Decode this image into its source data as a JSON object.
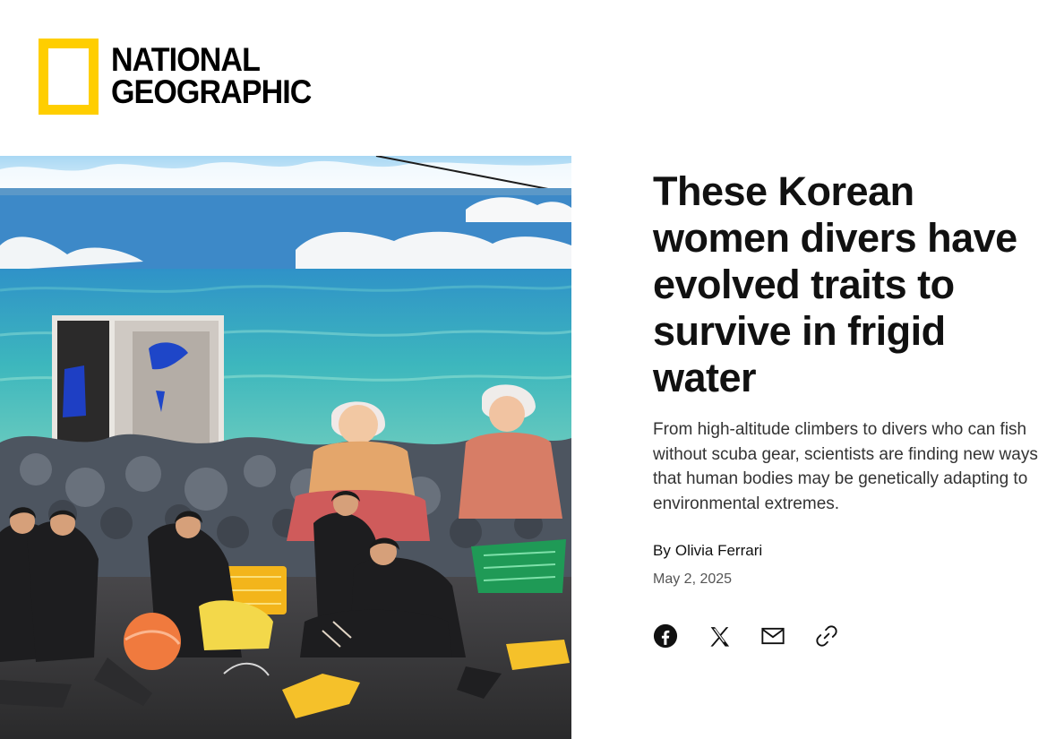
{
  "brand": {
    "logo_line1": "NATIONAL",
    "logo_line2": "GEOGRAPHIC",
    "accent_color": "#ffce00"
  },
  "article": {
    "headline": "These Korean women divers have evolved traits to survive in frigid water",
    "dek": "From high-altitude climbers to divers who can fish without scuba gear, scientists are finding new ways that human bodies may be genetically adapting to environmental extremes.",
    "byline_prefix": "By",
    "author": "Olivia Ferrari",
    "date": "May 2, 2025"
  },
  "share": [
    {
      "name": "facebook",
      "icon": "facebook-icon"
    },
    {
      "name": "x",
      "icon": "x-icon"
    },
    {
      "name": "email",
      "icon": "mail-icon"
    },
    {
      "name": "copy-link",
      "icon": "link-icon"
    }
  ]
}
